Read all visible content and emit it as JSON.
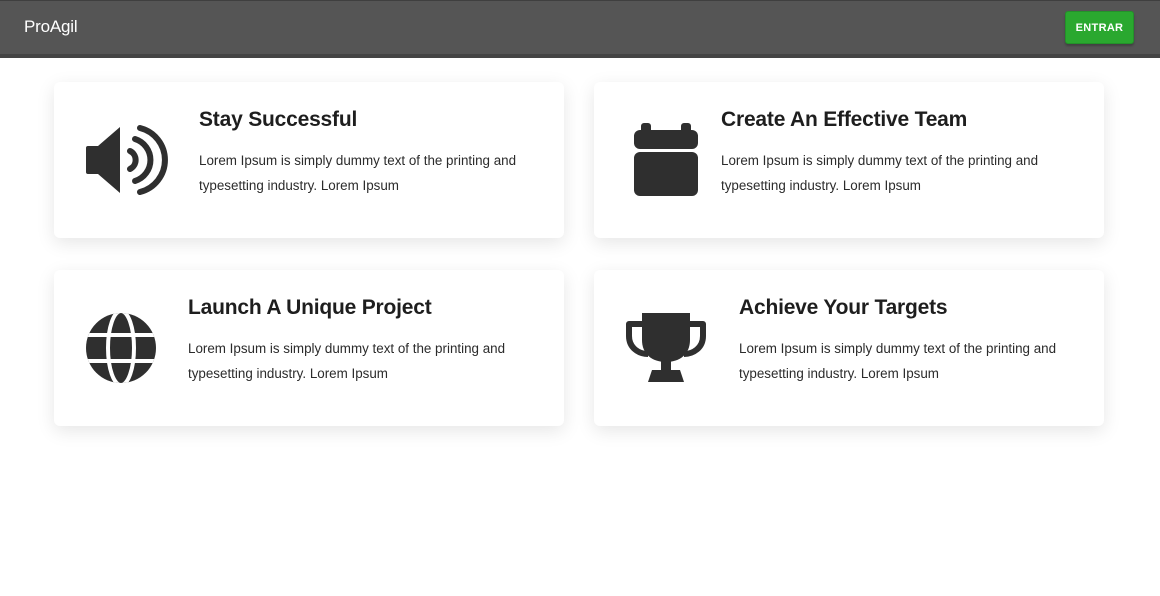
{
  "navbar": {
    "brand": "ProAgil",
    "login_button": "ENTRAR"
  },
  "features": [
    {
      "icon": "megaphone-icon",
      "title": "Stay Successful",
      "text": "Lorem Ipsum is simply dummy text of the printing and typesetting industry. Lorem Ipsum"
    },
    {
      "icon": "calendar-icon",
      "title": "Create An Effective Team",
      "text": "Lorem Ipsum is simply dummy text of the printing and typesetting industry. Lorem Ipsum"
    },
    {
      "icon": "globe-icon",
      "title": "Launch A Unique Project",
      "text": "Lorem Ipsum is simply dummy text of the printing and typesetting industry. Lorem Ipsum"
    },
    {
      "icon": "trophy-icon",
      "title": "Achieve Your Targets",
      "text": "Lorem Ipsum is simply dummy text of the printing and typesetting industry. Lorem Ipsum"
    }
  ],
  "colors": {
    "navbar_bg": "#555555",
    "button_green": "#2aa82f",
    "icon_color": "#2f2f2f"
  }
}
